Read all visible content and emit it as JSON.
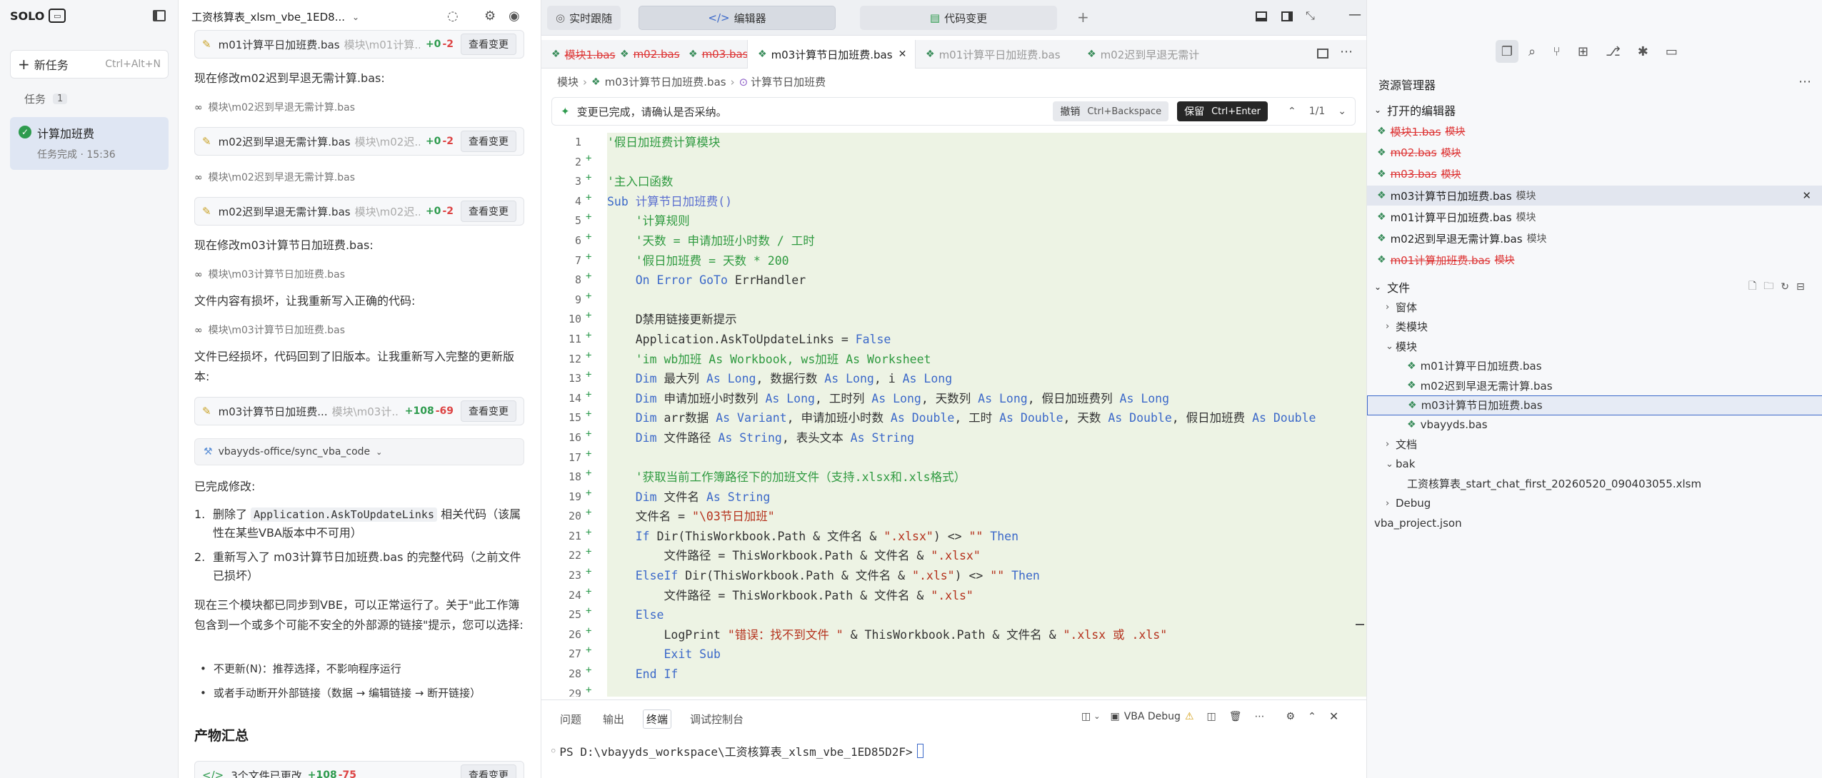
{
  "app": {
    "logo_text": "SOLO",
    "logo_icon": "terminal-icon"
  },
  "left": {
    "new_task": "新任务",
    "new_task_shortcut": "Ctrl+Alt+N",
    "tasks_label": "任务",
    "tasks_count": "1",
    "task_title": "计算加班费",
    "task_status": "任务完成 · 15:36"
  },
  "chat": {
    "title": "工资核算表_xlsm_vbe_1ED8...",
    "cards": [
      {
        "file": "m01计算平日加班费.bas",
        "path": "模块\\m01计算...",
        "plus": "+0",
        "minus": "-2",
        "btn": "查看变更"
      },
      {
        "file": "m02迟到早退无需计算.bas",
        "path": "模块\\m02迟...",
        "plus": "+0",
        "minus": "-2",
        "btn": "查看变更"
      },
      {
        "file": "m02迟到早退无需计算.bas",
        "path": "模块\\m02迟...",
        "plus": "+0",
        "minus": "-2",
        "btn": "查看变更"
      },
      {
        "file": "m03计算节日加班费...",
        "path": "模块\\m03计...",
        "plus": "+108",
        "minus": "-69",
        "btn": "查看变更"
      }
    ],
    "msg1": "现在修改m02迟到早退无需计算.bas:",
    "ref1": "模块\\m02迟到早退无需计算.bas",
    "ref2": "模块\\m02迟到早退无需计算.bas",
    "msg2": "现在修改m03计算节日加班费.bas:",
    "ref3": "模块\\m03计算节日加班费.bas",
    "msg3": "文件内容有损坏，让我重新写入正确的代码:",
    "ref4": "模块\\m03计算节日加班费.bas",
    "msg4": "文件已经损坏，代码回到了旧版本。让我重新写入完整的更新版本:",
    "tool": "vbayyds-office/sync_vba_code",
    "done": "已完成修改:",
    "item1_a": "删除了",
    "item1_code": "Application.AskToUpdateLinks",
    "item1_b": "相关代码（该属性在某些VBA版本中不可用）",
    "item2": "重新写入了 m03计算节日加班费.bas 的完整代码（之前文件已损坏）",
    "para": "现在三个模块都已同步到VBE，可以正常运行了。关于\"此工作簿包含到一个或多个可能不安全的外部源的链接\"提示，您可以选择:",
    "bullet1": "不更新(N)：推荐选择，不影响程序运行",
    "bullet2": "或者手动断开外部链接（数据 → 编辑链接 → 断开链接）",
    "summary_title": "产物汇总",
    "summary_text": "3个文件已更改",
    "summary_plus": "+108",
    "summary_minus": "-75",
    "summary_btn": "查看变更"
  },
  "editor": {
    "top_tabs": [
      "实时跟随",
      "编辑器",
      "代码变更"
    ],
    "file_tabs": [
      {
        "name": "模块1.bas",
        "state": "deleted"
      },
      {
        "name": "m02.bas",
        "state": "deleted"
      },
      {
        "name": "m03.bas",
        "state": "deleted"
      },
      {
        "name": "m03计算节日加班费.bas",
        "state": "active"
      },
      {
        "name": "m01计算平日加班费.bas",
        "state": "normal"
      },
      {
        "name": "m02迟到早退无需计",
        "state": "normal"
      }
    ],
    "breadcrumb": [
      "模块",
      "m03计算节日加班费.bas",
      "计算节日加班费"
    ],
    "notice": "变更已完成，请确认是否采纳。",
    "undo": "撤销",
    "undo_key": "Ctrl+Backspace",
    "keep": "保留",
    "keep_key": "Ctrl+Enter",
    "pager": "1/1",
    "lines": [
      [
        [
          "cm",
          "'假日加班费计算模块"
        ]
      ],
      [],
      [
        [
          "cm",
          "'主入口函数"
        ]
      ],
      [
        [
          "kw",
          "Sub "
        ],
        [
          "fnc",
          "计算节日加班费()"
        ]
      ],
      [
        [
          "",
          "    "
        ],
        [
          "cm",
          "'计算规则"
        ]
      ],
      [
        [
          "",
          "    "
        ],
        [
          "cm",
          "'天数 = 申请加班小时数 / 工时"
        ]
      ],
      [
        [
          "",
          "    "
        ],
        [
          "cm",
          "'假日加班费 = 天数 * 200"
        ]
      ],
      [
        [
          "",
          "    "
        ],
        [
          "kw",
          "On Error GoTo "
        ],
        [
          "",
          "ErrHandler"
        ]
      ],
      [],
      [
        [
          "",
          "    D禁用链接更新提示"
        ]
      ],
      [
        [
          "",
          "    Application.AskToUpdateLinks = "
        ],
        [
          "kw",
          "False"
        ]
      ],
      [
        [
          "",
          "    "
        ],
        [
          "cm",
          "'im wb加班 As Workbook, ws加班 As Worksheet"
        ]
      ],
      [
        [
          "",
          "    "
        ],
        [
          "kw",
          "Dim "
        ],
        [
          "",
          "最大列 "
        ],
        [
          "kw",
          "As Long"
        ],
        [
          "",
          ", 数据行数 "
        ],
        [
          "kw",
          "As Long"
        ],
        [
          "",
          ", i "
        ],
        [
          "kw",
          "As Long"
        ]
      ],
      [
        [
          "",
          "    "
        ],
        [
          "kw",
          "Dim "
        ],
        [
          "",
          "申请加班小时数列 "
        ],
        [
          "kw",
          "As Long"
        ],
        [
          "",
          ", 工时列 "
        ],
        [
          "kw",
          "As Long"
        ],
        [
          "",
          ", 天数列 "
        ],
        [
          "kw",
          "As Long"
        ],
        [
          "",
          ", 假日加班费列 "
        ],
        [
          "kw",
          "As Long"
        ]
      ],
      [
        [
          "",
          "    "
        ],
        [
          "kw",
          "Dim "
        ],
        [
          "",
          "arr数据 "
        ],
        [
          "kw",
          "As Variant"
        ],
        [
          "",
          ", 申请加班小时数 "
        ],
        [
          "kw",
          "As Double"
        ],
        [
          "",
          ", 工时 "
        ],
        [
          "kw",
          "As Double"
        ],
        [
          "",
          ", 天数 "
        ],
        [
          "kw",
          "As Double"
        ],
        [
          "",
          ", 假日加班费 "
        ],
        [
          "kw",
          "As Double"
        ]
      ],
      [
        [
          "",
          "    "
        ],
        [
          "kw",
          "Dim "
        ],
        [
          "",
          "文件路径 "
        ],
        [
          "kw",
          "As String"
        ],
        [
          "",
          ", 表头文本 "
        ],
        [
          "kw",
          "As String"
        ]
      ],
      [],
      [
        [
          "",
          "    "
        ],
        [
          "cm",
          "'获取当前工作簿路径下的加班文件（支持.xlsx和.xls格式）"
        ]
      ],
      [
        [
          "",
          "    "
        ],
        [
          "kw",
          "Dim "
        ],
        [
          "",
          "文件名 "
        ],
        [
          "kw",
          "As String"
        ]
      ],
      [
        [
          "",
          "    文件名 = "
        ],
        [
          "st",
          "\"\\03节日加班\""
        ]
      ],
      [
        [
          "",
          "    "
        ],
        [
          "kw",
          "If "
        ],
        [
          "",
          "Dir(ThisWorkbook.Path & 文件名 & "
        ],
        [
          "st",
          "\".xlsx\""
        ],
        [
          "",
          ") <> "
        ],
        [
          "st",
          "\"\""
        ],
        [
          "kw",
          " Then"
        ]
      ],
      [
        [
          "",
          "        文件路径 = ThisWorkbook.Path & 文件名 & "
        ],
        [
          "st",
          "\".xlsx\""
        ]
      ],
      [
        [
          "",
          "    "
        ],
        [
          "kw",
          "ElseIf "
        ],
        [
          "",
          "Dir(ThisWorkbook.Path & 文件名 & "
        ],
        [
          "st",
          "\".xls\""
        ],
        [
          "",
          ") <> "
        ],
        [
          "st",
          "\"\""
        ],
        [
          "kw",
          " Then"
        ]
      ],
      [
        [
          "",
          "        文件路径 = ThisWorkbook.Path & 文件名 & "
        ],
        [
          "st",
          "\".xls\""
        ]
      ],
      [
        [
          "",
          "    "
        ],
        [
          "kw",
          "Else"
        ]
      ],
      [
        [
          "",
          "        LogPrint "
        ],
        [
          "st",
          "\"错误：找不到文件 \""
        ],
        [
          "",
          " & ThisWorkbook.Path & 文件名 & "
        ],
        [
          "st",
          "\".xlsx 或 .xls\""
        ]
      ],
      [
        [
          "",
          "        "
        ],
        [
          "kw",
          "Exit Sub"
        ]
      ],
      [
        [
          "",
          "    "
        ],
        [
          "kw",
          "End If"
        ]
      ],
      []
    ],
    "panel_tabs": [
      "问题",
      "输出",
      "终端",
      "调试控制台"
    ],
    "debug_label": "VBA Debug",
    "terminal": "PS D:\\vbayyds_workspace\\工资核算表_xlsm_vbe_1ED85D2F>"
  },
  "explorer": {
    "title": "资源管理器",
    "open_editors": "打开的编辑器",
    "open_items": [
      {
        "name": "模块1.bas",
        "tag": "模块",
        "deleted": true
      },
      {
        "name": "m02.bas",
        "tag": "模块",
        "deleted": true
      },
      {
        "name": "m03.bas",
        "tag": "模块",
        "deleted": true
      },
      {
        "name": "m03计算节日加班费.bas",
        "tag": "模块",
        "deleted": false,
        "active": true
      },
      {
        "name": "m01计算平日加班费.bas",
        "tag": "模块",
        "deleted": false
      },
      {
        "name": "m02迟到早退无需计算.bas",
        "tag": "模块",
        "deleted": false
      },
      {
        "name": "m01计算加班费.bas",
        "tag": "模块",
        "deleted": true
      }
    ],
    "files_label": "文件",
    "tree": [
      {
        "label": "窗体",
        "indent": 1,
        "chev": "›"
      },
      {
        "label": "类模块",
        "indent": 1,
        "chev": "›"
      },
      {
        "label": "模块",
        "indent": 1,
        "chev": "⌄"
      },
      {
        "label": "m01计算平日加班费.bas",
        "indent": 2,
        "chev": "",
        "vb": true
      },
      {
        "label": "m02迟到早退无需计算.bas",
        "indent": 2,
        "chev": "",
        "vb": true
      },
      {
        "label": "m03计算节日加班费.bas",
        "indent": 2,
        "chev": "",
        "vb": true,
        "selected": true
      },
      {
        "label": "vbayyds.bas",
        "indent": 2,
        "chev": "",
        "vb": true
      },
      {
        "label": "文档",
        "indent": 1,
        "chev": "›"
      },
      {
        "label": "bak",
        "indent": 1,
        "chev": "⌄"
      },
      {
        "label": "工资核算表_start_chat_first_20260520_090403055.xlsm",
        "indent": 2,
        "chev": ""
      },
      {
        "label": "Debug",
        "indent": 1,
        "chev": "›"
      },
      {
        "label": "vba_project.json",
        "indent": 0,
        "chev": ""
      }
    ]
  }
}
